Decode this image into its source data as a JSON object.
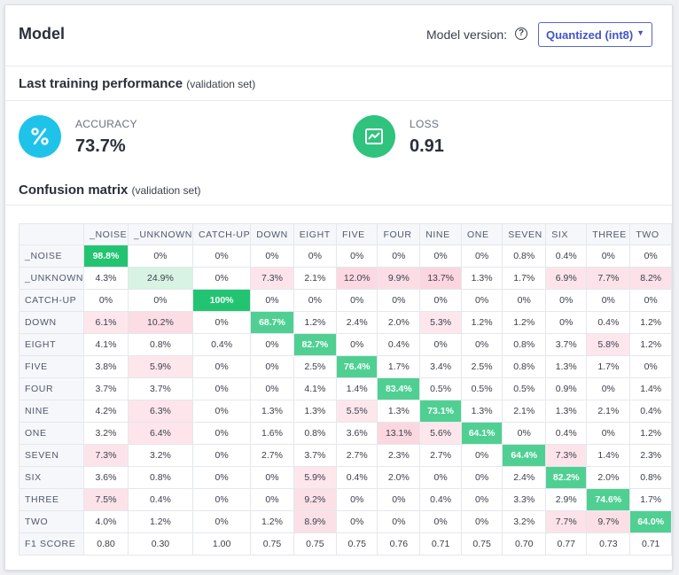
{
  "header": {
    "title": "Model",
    "model_version_label": "Model version:",
    "help_icon": "?",
    "version_selected": "Quantized (int8)"
  },
  "performance": {
    "title": "Last training performance",
    "subtitle": "(validation set)",
    "accuracy": {
      "label": "ACCURACY",
      "value": "73.7%",
      "icon": "percent-icon",
      "color": "#1fc3ea"
    },
    "loss": {
      "label": "LOSS",
      "value": "0.91",
      "icon": "line-chart-icon",
      "color": "#2fc37d"
    }
  },
  "confusion": {
    "title": "Confusion matrix",
    "subtitle": "(validation set)",
    "columns": [
      "_NOISE",
      "_UNKNOWN",
      "CATCH-UP",
      "DOWN",
      "EIGHT",
      "FIVE",
      "FOUR",
      "NINE",
      "ONE",
      "SEVEN",
      "SIX",
      "THREE",
      "TWO"
    ],
    "rows": [
      {
        "label": "_NOISE",
        "cells": [
          "98.8%",
          "0%",
          "0%",
          "0%",
          "0%",
          "0%",
          "0%",
          "0%",
          "0%",
          "0.8%",
          "0.4%",
          "0%",
          "0%"
        ]
      },
      {
        "label": "_UNKNOWN",
        "cells": [
          "4.3%",
          "24.9%",
          "0%",
          "7.3%",
          "2.1%",
          "12.0%",
          "9.9%",
          "13.7%",
          "1.3%",
          "1.7%",
          "6.9%",
          "7.7%",
          "8.2%"
        ]
      },
      {
        "label": "CATCH-UP",
        "cells": [
          "0%",
          "0%",
          "100%",
          "0%",
          "0%",
          "0%",
          "0%",
          "0%",
          "0%",
          "0%",
          "0%",
          "0%",
          "0%"
        ]
      },
      {
        "label": "DOWN",
        "cells": [
          "6.1%",
          "10.2%",
          "0%",
          "68.7%",
          "1.2%",
          "2.4%",
          "2.0%",
          "5.3%",
          "1.2%",
          "1.2%",
          "0%",
          "0.4%",
          "1.2%"
        ]
      },
      {
        "label": "EIGHT",
        "cells": [
          "4.1%",
          "0.8%",
          "0.4%",
          "0%",
          "82.7%",
          "0%",
          "0.4%",
          "0%",
          "0%",
          "0.8%",
          "3.7%",
          "5.8%",
          "1.2%"
        ]
      },
      {
        "label": "FIVE",
        "cells": [
          "3.8%",
          "5.9%",
          "0%",
          "0%",
          "2.5%",
          "76.4%",
          "1.7%",
          "3.4%",
          "2.5%",
          "0.8%",
          "1.3%",
          "1.7%",
          "0%"
        ]
      },
      {
        "label": "FOUR",
        "cells": [
          "3.7%",
          "3.7%",
          "0%",
          "0%",
          "4.1%",
          "1.4%",
          "83.4%",
          "0.5%",
          "0.5%",
          "0.5%",
          "0.9%",
          "0%",
          "1.4%"
        ]
      },
      {
        "label": "NINE",
        "cells": [
          "4.2%",
          "6.3%",
          "0%",
          "1.3%",
          "1.3%",
          "5.5%",
          "1.3%",
          "73.1%",
          "1.3%",
          "2.1%",
          "1.3%",
          "2.1%",
          "0.4%"
        ]
      },
      {
        "label": "ONE",
        "cells": [
          "3.2%",
          "6.4%",
          "0%",
          "1.6%",
          "0.8%",
          "3.6%",
          "13.1%",
          "5.6%",
          "64.1%",
          "0%",
          "0.4%",
          "0%",
          "1.2%"
        ]
      },
      {
        "label": "SEVEN",
        "cells": [
          "7.3%",
          "3.2%",
          "0%",
          "2.7%",
          "3.7%",
          "2.7%",
          "2.3%",
          "2.7%",
          "0%",
          "64.4%",
          "7.3%",
          "1.4%",
          "2.3%"
        ]
      },
      {
        "label": "SIX",
        "cells": [
          "3.6%",
          "0.8%",
          "0%",
          "0%",
          "5.9%",
          "0.4%",
          "2.0%",
          "0%",
          "0%",
          "2.4%",
          "82.2%",
          "2.0%",
          "0.8%"
        ]
      },
      {
        "label": "THREE",
        "cells": [
          "7.5%",
          "0.4%",
          "0%",
          "0%",
          "9.2%",
          "0%",
          "0%",
          "0.4%",
          "0%",
          "3.3%",
          "2.9%",
          "74.6%",
          "1.7%"
        ]
      },
      {
        "label": "TWO",
        "cells": [
          "4.0%",
          "1.2%",
          "0%",
          "1.2%",
          "8.9%",
          "0%",
          "0%",
          "0%",
          "0%",
          "3.2%",
          "7.7%",
          "9.7%",
          "64.0%"
        ]
      }
    ],
    "f1_row": {
      "label": "F1 SCORE",
      "cells": [
        "0.80",
        "0.30",
        "1.00",
        "0.75",
        "0.75",
        "0.75",
        "0.76",
        "0.71",
        "0.75",
        "0.70",
        "0.77",
        "0.73",
        "0.71"
      ]
    },
    "colors": {
      "diagonal": "#3cc98a",
      "diagonal_high": "#22c472",
      "off_diagonal": "#fde9ee"
    }
  }
}
